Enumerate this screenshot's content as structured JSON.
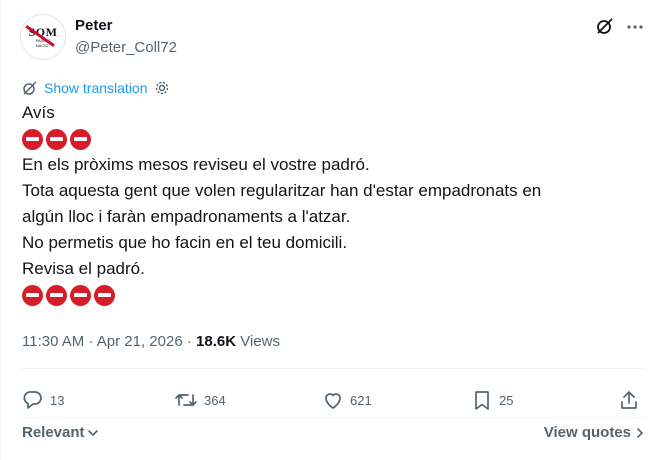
{
  "author": {
    "name": "Peter",
    "handle": "@Peter_Coll72",
    "avatar_text": "SOM",
    "avatar_subtext": "SOM PAÏSOS ESTIMAT SOM NACIO VOLEM"
  },
  "translate": {
    "label": "Show translation",
    "icon": "globe-translate-icon",
    "settings_icon": "gear-icon"
  },
  "post": {
    "lines": [
      "Avís",
      "En els pròxims mesos reviseu el vostre padró.",
      "Tota aquesta gent que volen regularitzar han d'estar empadronats en",
      "algún lloc i faràn empadronaments a l'atzar.",
      "No permetis que ho facin en el teu domicili.",
      "Revisa el padró."
    ],
    "emoji_rows": [
      {
        "count": 3,
        "emoji": "no-entry"
      },
      {
        "count": 4,
        "emoji": "no-entry"
      }
    ]
  },
  "meta": {
    "time": "11:30 AM",
    "date": "Apr 21, 2026",
    "views_count": "18.6K",
    "views_label": "Views"
  },
  "actions": {
    "replies": "13",
    "reposts": "364",
    "likes": "621",
    "bookmarks": "25"
  },
  "footer": {
    "sort_label": "Relevant",
    "view_quotes_label": "View quotes"
  },
  "colors": {
    "accent": "#1d9bf0",
    "muted": "#536471",
    "text": "#0f1419",
    "no_entry_red": "#d71c2a"
  }
}
